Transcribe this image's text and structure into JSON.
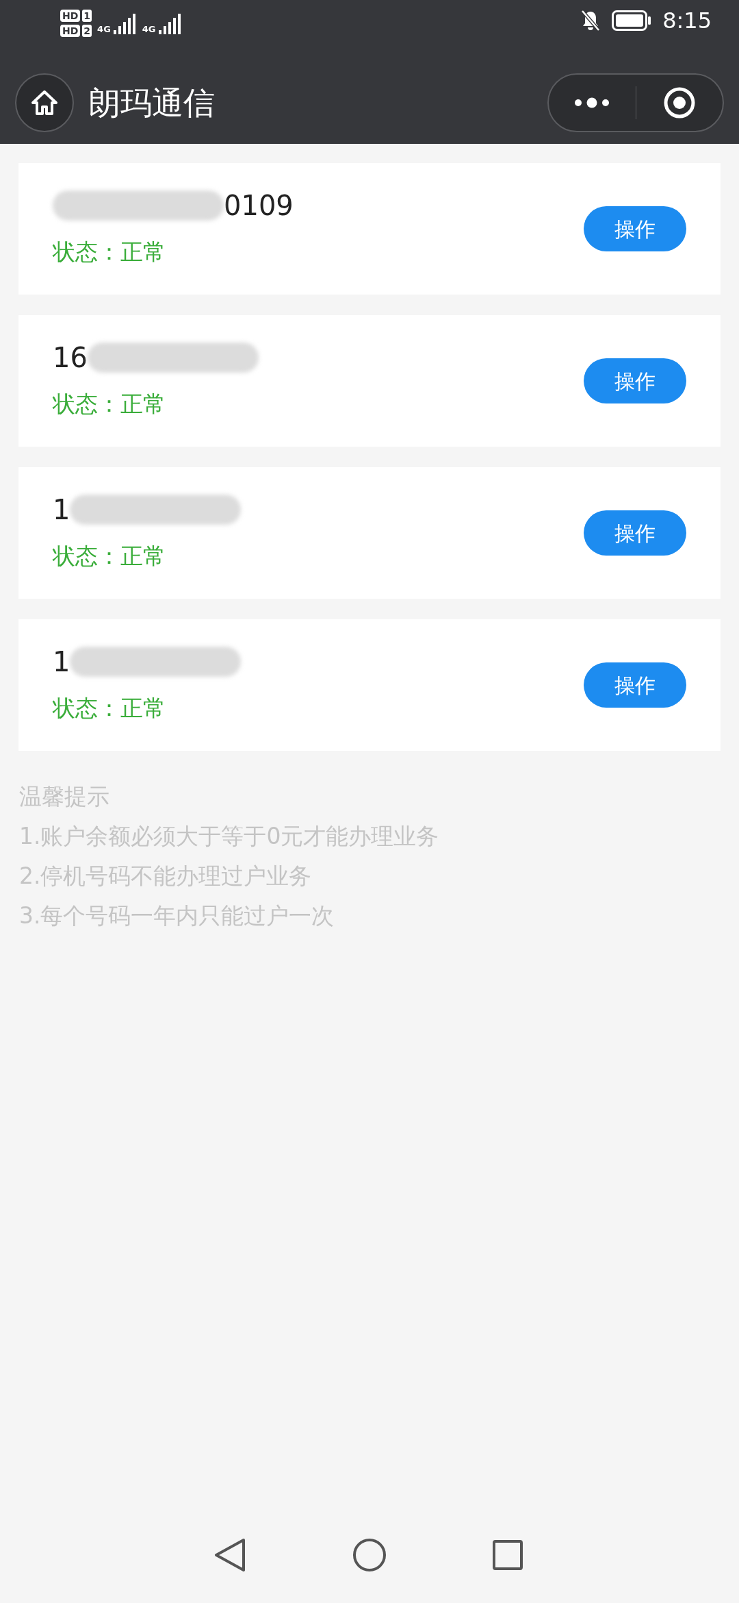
{
  "status_bar": {
    "sims": [
      {
        "badge": "HD",
        "slot": "1",
        "network": "4G"
      },
      {
        "badge": "HD",
        "slot": "2",
        "network": "4G"
      }
    ],
    "muted": true,
    "time": "8:15"
  },
  "nav_bar": {
    "title": "朗玛通信"
  },
  "lines": [
    {
      "number_end": "0109",
      "status_label": "状态：",
      "status": "正常",
      "button": "操作"
    },
    {
      "number_start": "16",
      "status_label": "状态：",
      "status": "正常",
      "button": "操作"
    },
    {
      "number_start": "1",
      "status_label": "状态：",
      "status": "正常",
      "button": "操作"
    },
    {
      "number_start": "1",
      "status_label": "状态：",
      "status": "正常",
      "button": "操作"
    }
  ],
  "tips": {
    "title": "温馨提示",
    "items": [
      "1.账户余额必须大于等于0元才能办理业务",
      "2.停机号码不能办理过户业务",
      "3.每个号码一年内只能过户一次"
    ]
  }
}
